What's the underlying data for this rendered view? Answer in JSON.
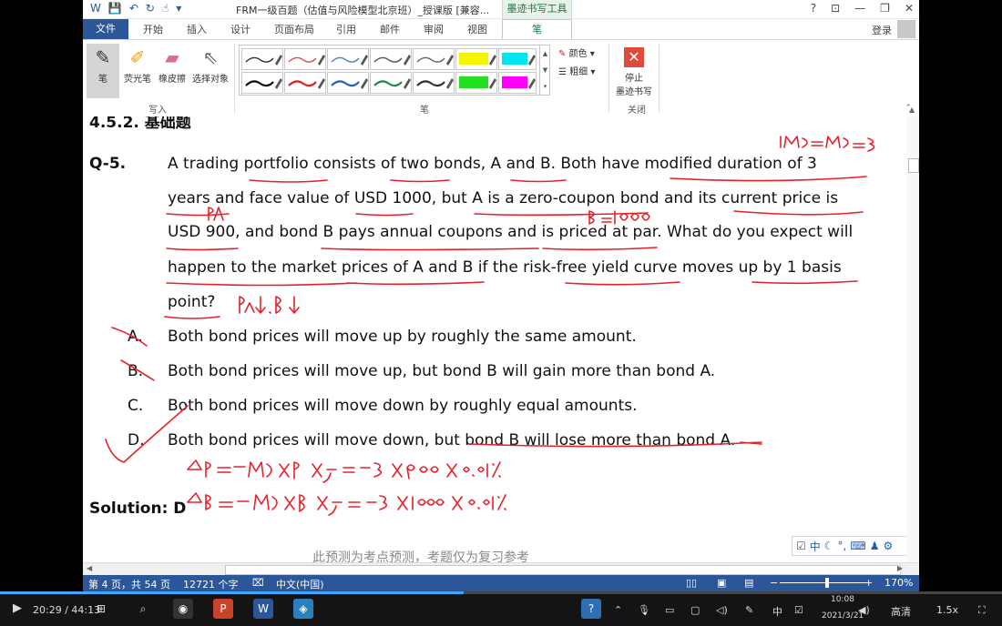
{
  "window": {
    "title": "FRM一级百题（估值与风险模型北京班）_授课版 [兼容...",
    "contextual_tab_group": "墨迹书写工具",
    "help": "?",
    "controls": [
      "?",
      "⊡",
      "—",
      "❐",
      "✕"
    ]
  },
  "ribbon_tabs": {
    "file": "文件",
    "items": [
      "开始",
      "插入",
      "设计",
      "页面布局",
      "引用",
      "邮件",
      "审阅",
      "视图"
    ],
    "active": "笔",
    "login": "登录"
  },
  "ribbon": {
    "write_group": {
      "label": "写入",
      "tools": [
        {
          "label": "笔",
          "icon": "pen-icon"
        },
        {
          "label": "荧光笔",
          "icon": "highlighter-icon"
        },
        {
          "label": "橡皮擦",
          "icon": "eraser-icon"
        },
        {
          "label": "选择对象",
          "icon": "select-pointer-icon"
        }
      ]
    },
    "pen_group": {
      "label": "笔",
      "color_label": "颜色",
      "weight_label": "粗细",
      "swatches_row1": [
        "#333333",
        "#e04b5a",
        "#4a7fd4",
        "#555555",
        "#666666",
        "#f5f500",
        "#00e5f0"
      ],
      "swatches_row2": [
        "#111111",
        "#e02020",
        "#2a5fc0",
        "#1f8a4c",
        "#333333",
        "#22e022",
        "#ff00ff"
      ]
    },
    "close_group": {
      "label": "关闭",
      "stop_label_1": "停止",
      "stop_label_2": "墨迹书写"
    }
  },
  "document": {
    "section_heading": "4.5.2.  基础题",
    "question_label": "Q-5.",
    "question_lines": [
      "A trading portfolio consists of two bonds, A and B. Both have modified duration of 3",
      "years and face value of USD 1000, but A is a zero-coupon bond and its current price is",
      "USD 900, and bond B pays annual coupons and is priced at par. What do you expect will",
      "happen to the market prices of A and B if the risk-free yield curve moves up by 1 basis",
      "point?"
    ],
    "options": [
      {
        "letter": "A.",
        "text": "Both bond prices will move up by roughly the same amount."
      },
      {
        "letter": "B.",
        "text": "Both bond prices will move up, but bond B will gain more than bond A."
      },
      {
        "letter": "C.",
        "text": "Both bond prices will move down by roughly equal amounts."
      },
      {
        "letter": "D.",
        "text": "Both bond prices will move down, but bond B will lose more than bond A."
      }
    ],
    "solution": "Solution: D",
    "footer_text": "此预测为考点预测，考题仅为复习参考",
    "ink_notes": {
      "md_eq": "MDA=MDB=3",
      "pa": "PA",
      "pb": "PB=1000",
      "prices_down": "PA↓. PB↓",
      "delta_pa": "ΔPA=-MDA×PA×Δy=-3×900×0.01%",
      "delta_pb": "ΔPB=-MDB×PB×Δy=-3×1000×0.01%"
    }
  },
  "statusbar": {
    "page": "第 4 页，共 54 页",
    "words": "12721 个字",
    "language": "中文(中国)",
    "zoom": "170%"
  },
  "player": {
    "time": "20:29 / 44:13",
    "quality": "高清",
    "speed": "1.5x",
    "progress": 0.463
  },
  "taskbar": {
    "clock_time": "10:08",
    "clock_date": "2021/3/21",
    "ime": "中"
  }
}
